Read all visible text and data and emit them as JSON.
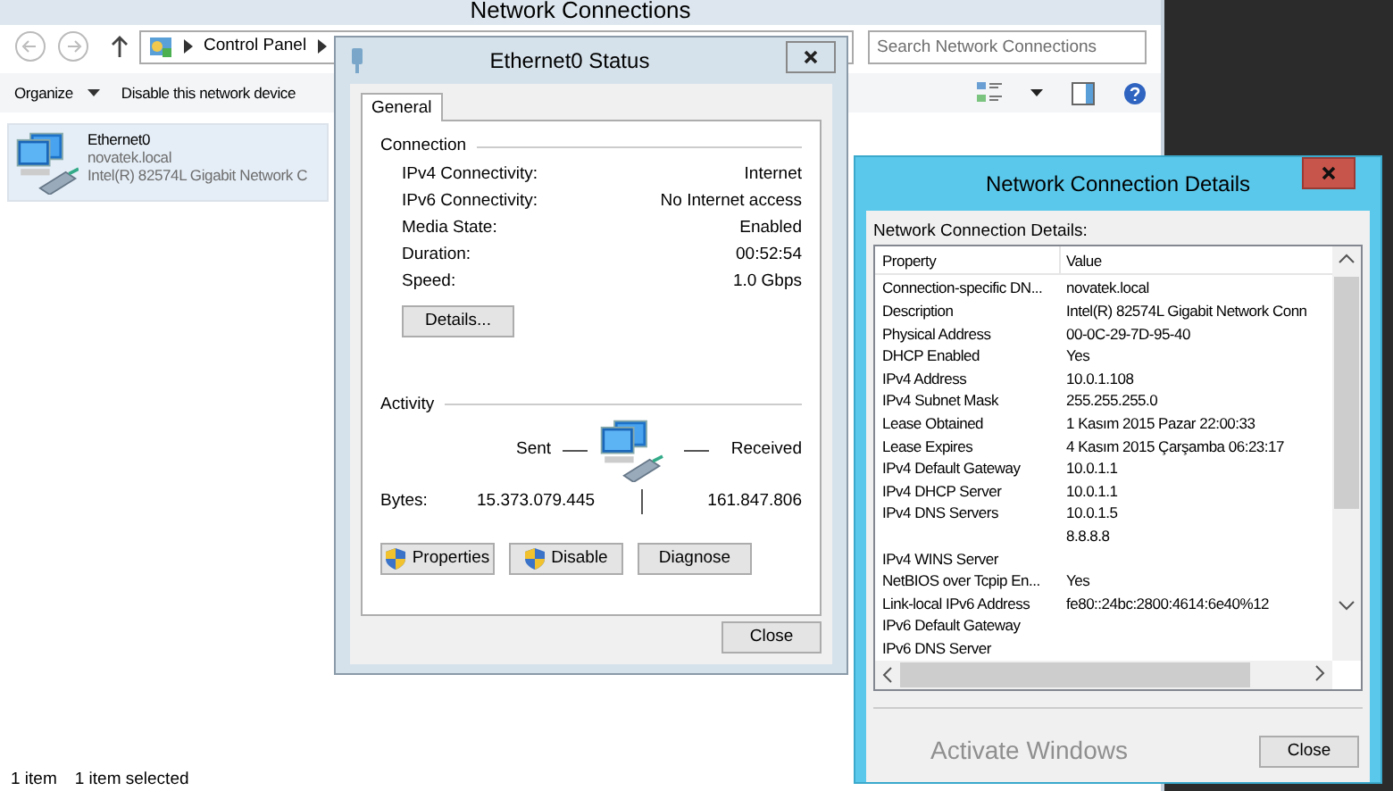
{
  "explorer": {
    "title": "Network Connections",
    "address": [
      "Control Panel"
    ],
    "search": {
      "placeholder": "Search Network Connections"
    },
    "toolbar": [
      "Organize",
      "Disable this network device"
    ],
    "items": [
      {
        "name": "Ethernet0",
        "network": "novatek.local",
        "adapter": "Intel(R) 82574L Gigabit Network C",
        "selected": true
      }
    ],
    "status_bar": [
      "1 item",
      "1 item selected"
    ]
  },
  "status_dialog": {
    "title": "Ethernet0 Status",
    "tabs": [
      {
        "label": "General",
        "selected": true
      }
    ],
    "connection": {
      "heading": "Connection",
      "rows": [
        {
          "label": "IPv4 Connectivity:",
          "value": "Internet"
        },
        {
          "label": "IPv6 Connectivity:",
          "value": "No Internet access"
        },
        {
          "label": "Media State:",
          "value": "Enabled"
        },
        {
          "label": "Duration:",
          "value": "00:52:54"
        },
        {
          "label": "Speed:",
          "value": "1.0 Gbps"
        }
      ]
    },
    "details_button": "Details...",
    "activity": {
      "heading": "Activity",
      "sent_label": "Sent",
      "received_label": "Received",
      "bytes_label": "Bytes:",
      "sent": "15.373.079.445",
      "received": "161.847.806"
    },
    "buttons": [
      {
        "label": "Properties",
        "shield": true
      },
      {
        "label": "Disable",
        "shield": true
      },
      {
        "label": "Diagnose",
        "shield": false
      }
    ],
    "close": "Close"
  },
  "details_dialog": {
    "title": "Network Connection Details",
    "caption": "Network Connection Details:",
    "columns": [
      "Property",
      "Value"
    ],
    "rows": [
      {
        "property": "Connection-specific DN...",
        "value": "novatek.local"
      },
      {
        "property": "Description",
        "value": "Intel(R) 82574L Gigabit Network Conn"
      },
      {
        "property": "Physical Address",
        "value": "00-0C-29-7D-95-40"
      },
      {
        "property": "DHCP Enabled",
        "value": "Yes"
      },
      {
        "property": "IPv4 Address",
        "value": "10.0.1.108"
      },
      {
        "property": "IPv4 Subnet Mask",
        "value": "255.255.255.0"
      },
      {
        "property": "Lease Obtained",
        "value": "1 Kasım 2015 Pazar 22:00:33"
      },
      {
        "property": "Lease Expires",
        "value": "4 Kasım 2015 Çarşamba 06:23:17"
      },
      {
        "property": "IPv4 Default Gateway",
        "value": "10.0.1.1"
      },
      {
        "property": "IPv4 DHCP Server",
        "value": "10.0.1.1"
      },
      {
        "property": "IPv4 DNS Servers",
        "value": "10.0.1.5"
      },
      {
        "value": "8.8.8.8"
      },
      {
        "property": "IPv4 WINS Server"
      },
      {
        "property": "NetBIOS over Tcpip En...",
        "value": "Yes"
      },
      {
        "property": "Link-local IPv6 Address",
        "value": "fe80::24bc:2800:4614:6e40%12"
      },
      {
        "property": "IPv6 Default Gateway"
      },
      {
        "property": "IPv6 DNS Server"
      }
    ],
    "close": "Close"
  },
  "watermark": "Activate Windows"
}
